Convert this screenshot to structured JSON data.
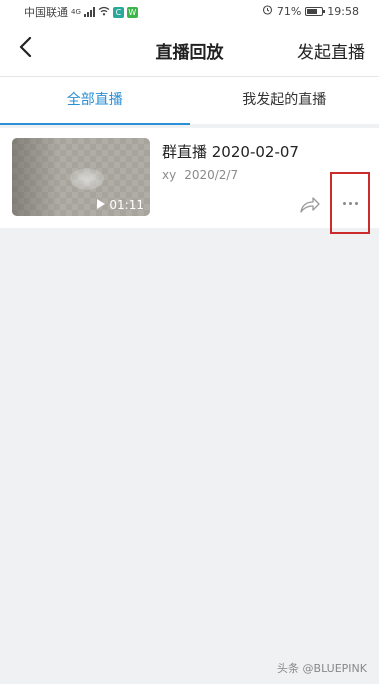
{
  "status_bar": {
    "carrier": "中国联通",
    "network_type": "4G",
    "battery": "71%",
    "battery_level": 0.71,
    "time": "19:58"
  },
  "navbar": {
    "title": "直播回放",
    "action_label": "发起直播"
  },
  "tabs": [
    {
      "label": "全部直播",
      "active": true
    },
    {
      "label": "我发起的直播",
      "active": false
    }
  ],
  "replays": [
    {
      "title": "群直播 2020-02-07",
      "host": "xy",
      "date": "2020/2/7",
      "duration": "01:11"
    }
  ],
  "watermark": "头条 @BLUEPINK",
  "colors": {
    "accent": "#2a8fd4",
    "highlight_box": "#cc2b2b",
    "background": "#f0f1f3"
  }
}
